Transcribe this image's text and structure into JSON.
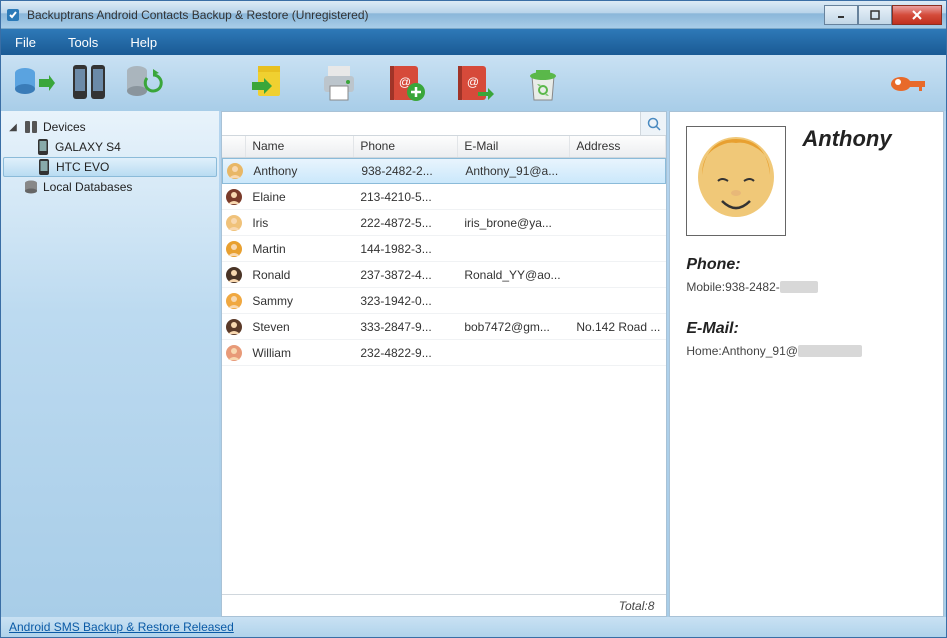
{
  "window": {
    "title": "Backuptrans Android Contacts Backup & Restore (Unregistered)"
  },
  "menubar": {
    "items": [
      "File",
      "Tools",
      "Help"
    ]
  },
  "sidebar": {
    "root": "Devices",
    "items": [
      "GALAXY S4",
      "HTC EVO"
    ],
    "local": "Local Databases"
  },
  "search": {
    "placeholder": ""
  },
  "table": {
    "headers": {
      "name": "Name",
      "phone": "Phone",
      "email": "E-Mail",
      "address": "Address"
    },
    "rows": [
      {
        "name": "Anthony",
        "phone": "938-2482-2...",
        "email": "Anthony_91@a...",
        "address": "",
        "avatar": "#e8b766"
      },
      {
        "name": "Elaine",
        "phone": "213-4210-5...",
        "email": "",
        "address": "",
        "avatar": "#7a3b2a"
      },
      {
        "name": "Iris",
        "phone": "222-4872-5...",
        "email": "iris_brone@ya...",
        "address": "",
        "avatar": "#f0c27a"
      },
      {
        "name": "Martin",
        "phone": "144-1982-3...",
        "email": "",
        "address": "",
        "avatar": "#e8a030"
      },
      {
        "name": "Ronald",
        "phone": "237-3872-4...",
        "email": "Ronald_YY@ao...",
        "address": "",
        "avatar": "#4a3426"
      },
      {
        "name": "Sammy",
        "phone": "323-1942-0...",
        "email": "",
        "address": "",
        "avatar": "#f0a840"
      },
      {
        "name": "Steven",
        "phone": "333-2847-9...",
        "email": "bob7472@gm...",
        "address": "No.142 Road ...",
        "avatar": "#5b3a28"
      },
      {
        "name": "William",
        "phone": "232-4822-9...",
        "email": "",
        "address": "",
        "avatar": "#e89a78"
      }
    ],
    "total_label": "Total:8"
  },
  "detail": {
    "name": "Anthony",
    "phone_label": "Phone:",
    "phone_type": "Mobile:",
    "phone_value": "938-2482-",
    "email_label": "E-Mail:",
    "email_type": "Home:",
    "email_value": "Anthony_91@"
  },
  "footer": {
    "link": "Android SMS Backup & Restore Released"
  }
}
